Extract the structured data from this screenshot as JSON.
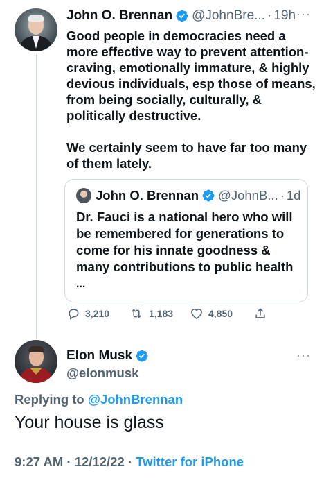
{
  "original_tweet": {
    "author_name": "John O. Brennan",
    "author_handle": "@JohnBre...",
    "separator": "·",
    "time": "19h",
    "paragraphs": [
      "Good people in democracies need a more effective way to prevent attention-craving, emotionally immature, & highly devious individuals, esp those of means, from being socially, culturally, & politically destructive.",
      "We certainly seem to have far too many of them lately."
    ],
    "quoted_tweet": {
      "author_name": "John O. Brennan",
      "author_handle": "@JohnB...",
      "separator": "·",
      "time": "1d",
      "text": "Dr. Fauci is a national hero who will be remembered for generations to come for his innate goodness & many contributions to public health",
      "ellipsis": "..."
    },
    "actions": {
      "replies": "3,210",
      "retweets": "1,183",
      "likes": "4,850"
    },
    "more_label": "···"
  },
  "reply_tweet": {
    "author_name": "Elon Musk",
    "author_handle": "@elonmusk",
    "more_label": "···",
    "replying_prefix": "Replying to",
    "replying_to": "@JohnBrennan",
    "text": "Your house is glass",
    "time": "9:27 AM",
    "separator1": "·",
    "date": "12/12/22",
    "separator2": "·",
    "source": "Twitter for iPhone"
  },
  "colors": {
    "verified": "#1d9bf0",
    "link": "#1d9bf0",
    "secondary_text": "#536471",
    "border": "#cfd9de"
  },
  "icons": {
    "verified": "verified-badge-icon",
    "reply": "reply-icon",
    "retweet": "retweet-icon",
    "like": "heart-icon",
    "share": "share-icon",
    "more": "more-options-icon"
  }
}
